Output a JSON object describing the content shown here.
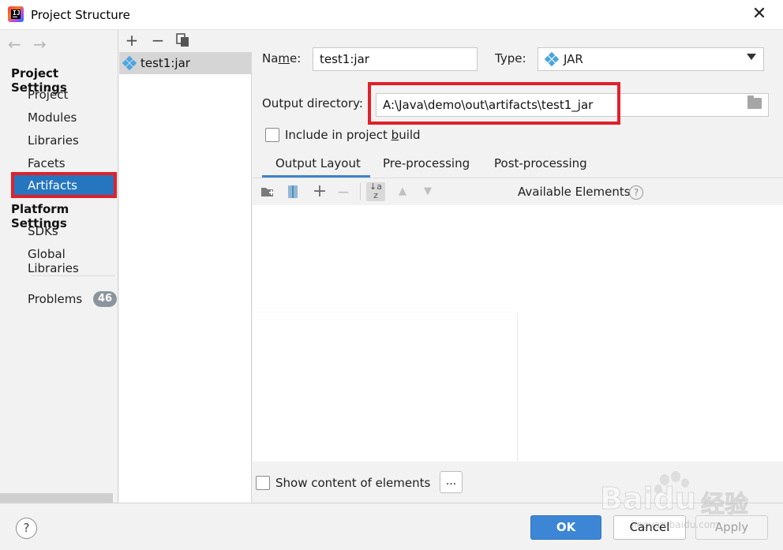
{
  "window": {
    "title": "Project Structure",
    "close_glyph": "✕"
  },
  "nav": {
    "back_glyph": "←",
    "forward_glyph": "→",
    "project_settings_header": "Project Settings",
    "project_settings_items": [
      "Project",
      "Modules",
      "Libraries",
      "Facets",
      "Artifacts"
    ],
    "selected_item": "Artifacts",
    "platform_settings_header": "Platform Settings",
    "platform_settings_items": [
      "SDKs",
      "Global Libraries"
    ],
    "problems_label": "Problems",
    "problems_count": "46"
  },
  "artifact_list": {
    "add_glyph": "+",
    "remove_glyph": "−",
    "items": [
      {
        "label": "test1:jar",
        "icon": "jar-artifact-icon"
      }
    ]
  },
  "form": {
    "name_label_pre": "Na",
    "name_label_mnemonic": "m",
    "name_label_post": "e:",
    "name_value": "test1:jar",
    "type_label": "Type:",
    "type_value": "JAR",
    "output_dir_label": "Output directory:",
    "output_dir_value": "A:\\Java\\demo\\out\\artifacts\\test1_jar",
    "include_build_pre": "Include in project ",
    "include_build_mnemonic": "b",
    "include_build_post": "uild",
    "include_build_checked": false
  },
  "tabs": [
    "Output Layout",
    "Pre-processing",
    "Post-processing"
  ],
  "active_tab": "Output Layout",
  "layout_toolbar": {
    "add_glyph": "+",
    "remove_glyph": "−",
    "sort_glyph_top": "↓a",
    "sort_glyph_bottom": "z",
    "up_glyph": "▲",
    "down_glyph": "▼",
    "available_elements_label": "Available Elements",
    "help_glyph": "?"
  },
  "show_content_label": "Show content of elements",
  "show_content_checked": false,
  "more_button_label": "...",
  "footer": {
    "help_glyph": "?",
    "ok_label": "OK",
    "cancel_label": "Cancel",
    "apply_label": "Apply"
  },
  "watermark": {
    "brand": "Baidu",
    "cjk": "经验",
    "url": "jingyan.baidu.com"
  },
  "colors": {
    "selection": "#2675bf",
    "highlight_box": "#e0212a",
    "ok_button": "#3d86d6",
    "badge": "#8c959e"
  }
}
